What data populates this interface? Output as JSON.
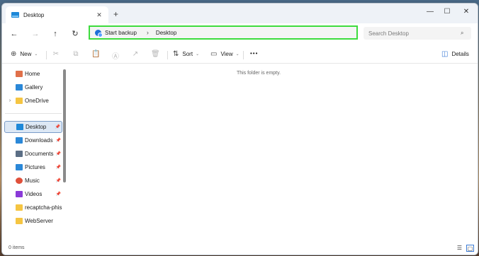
{
  "window": {
    "tab_title": "Desktop",
    "tab_close": "✕",
    "new_tab": "+",
    "minimize": "—",
    "maximize": "☐",
    "close": "✕"
  },
  "nav": {
    "back": "←",
    "forward": "→",
    "up": "↑",
    "refresh": "↻"
  },
  "address": {
    "crumbs": [
      "Start backup",
      "Desktop"
    ],
    "separator": "›"
  },
  "search": {
    "placeholder": "Search Desktop",
    "icon": "⌕"
  },
  "toolbar": {
    "new_label": "New",
    "new_icon": "⊕",
    "sort_label": "Sort",
    "sort_icon": "⇅",
    "view_label": "View",
    "view_icon": "▭",
    "more_label": "•••",
    "details_label": "Details",
    "details_icon": "◫",
    "chevron": "⌄",
    "cut_icon": "✂",
    "copy_icon": "⧉",
    "paste_icon": "📋",
    "rename_icon": "Ⓐ",
    "share_icon": "↗",
    "delete_icon": "🗑"
  },
  "sidebar": {
    "items": [
      {
        "label": "Home",
        "icon": "home-icon",
        "color": "#e0704a"
      },
      {
        "label": "Gallery",
        "icon": "gallery-icon",
        "color": "#2b88d8"
      },
      {
        "label": "OneDrive",
        "icon": "onedrive-icon",
        "color": "#f5c542"
      },
      {
        "label": "Desktop",
        "icon": "desktop-icon",
        "color": "#1e88d8"
      },
      {
        "label": "Downloads",
        "icon": "downloads-icon",
        "color": "#2b88d8"
      },
      {
        "label": "Documents",
        "icon": "documents-icon",
        "color": "#5b6e85"
      },
      {
        "label": "Pictures",
        "icon": "pictures-icon",
        "color": "#2b88d8"
      },
      {
        "label": "Music",
        "icon": "music-icon",
        "color": "#e0503a"
      },
      {
        "label": "Videos",
        "icon": "videos-icon",
        "color": "#8a3ad8"
      },
      {
        "label": "recaptcha-phish",
        "icon": "folder-icon",
        "color": "#f5c542"
      },
      {
        "label": "WebServer",
        "icon": "folder-icon",
        "color": "#f5c542"
      }
    ],
    "expand_glyph": "›",
    "pin_glyph": "📌"
  },
  "main": {
    "empty_message": "This folder is empty."
  },
  "status": {
    "items_count": "0 items",
    "details_view_icon": "☰",
    "tiles_view_icon": "▢"
  },
  "colors": {
    "accent": "#3b7bd5",
    "address_border": "#3ddc3d"
  }
}
